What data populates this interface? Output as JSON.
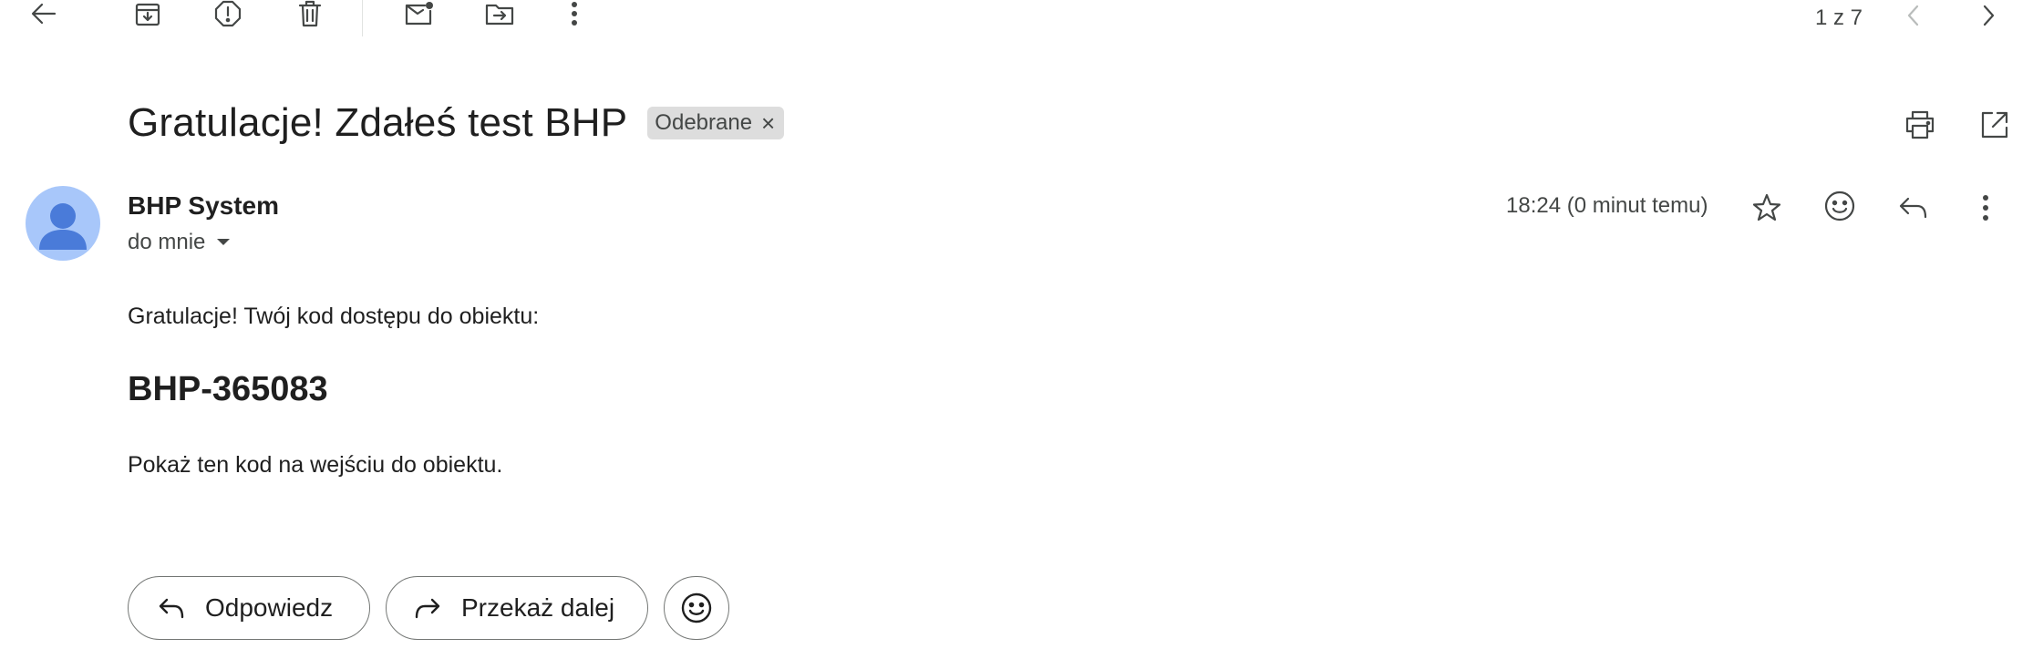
{
  "toolbar": {
    "page_count": "1 z 7",
    "icons": [
      "back-arrow-icon",
      "archive-icon",
      "report-spam-icon",
      "delete-icon",
      "mark-unread-icon",
      "move-to-icon",
      "more-vert-icon",
      "chevron-left-icon",
      "chevron-right-icon"
    ]
  },
  "email": {
    "subject": "Gratulacje! Zdałeś test BHP",
    "label": "Odebrane",
    "label_remove": "×",
    "sender_name": "BHP System",
    "recipient": "do mnie",
    "timestamp": "18:24 (0 minut temu)",
    "body": {
      "intro": "Gratulacje! Twój kod dostępu do obiektu:",
      "code": "BHP-365083",
      "instruction": "Pokaż ten kod na wejściu do obiektu."
    }
  },
  "actions": {
    "reply_label": "Odpowiedz",
    "forward_label": "Przekaż dalej"
  },
  "colors": {
    "avatar_bg": "#a8c7fa",
    "avatar_fg": "#4a7bd9",
    "label_bg": "#dddddd",
    "icon": "#444746"
  }
}
